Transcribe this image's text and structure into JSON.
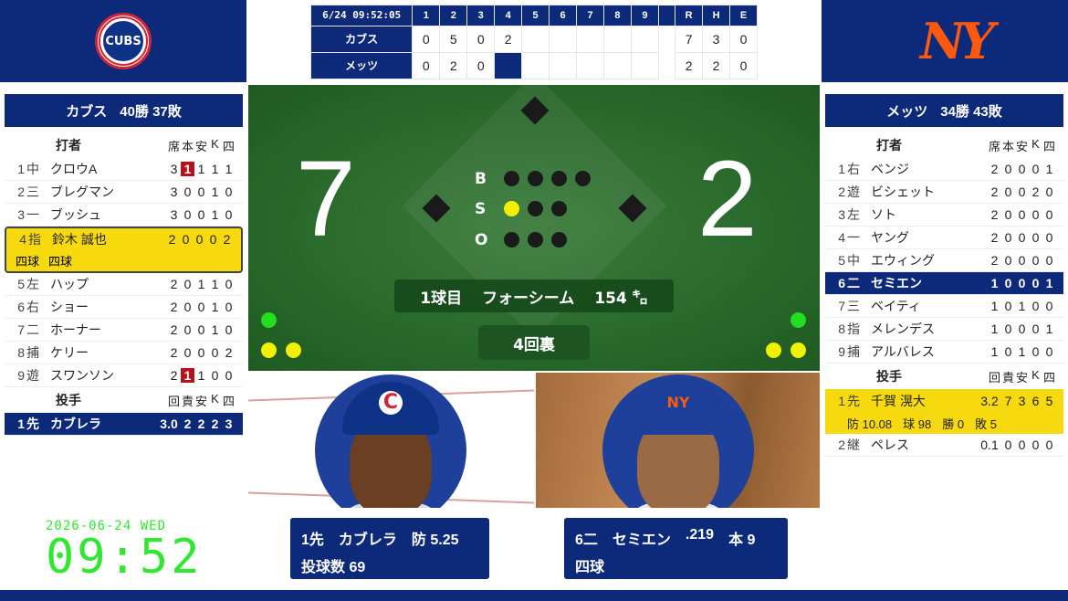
{
  "linescore": {
    "time": "6/24 09:52:05",
    "innings": [
      "1",
      "2",
      "3",
      "4",
      "5",
      "6",
      "7",
      "8",
      "9"
    ],
    "rhe": [
      "R",
      "H",
      "E"
    ],
    "teams": [
      {
        "name": "カブス",
        "scores": [
          "0",
          "5",
          "0",
          "2",
          "",
          "",
          "",
          "",
          ""
        ],
        "r": "7",
        "h": "3",
        "e": "0"
      },
      {
        "name": "メッツ",
        "scores": [
          "0",
          "2",
          "0",
          "",
          "",
          "",
          "",
          "",
          ""
        ],
        "r": "2",
        "h": "2",
        "e": "0"
      }
    ]
  },
  "logos": {
    "cubs": "CUBS",
    "mets": "NY"
  },
  "left_team": {
    "name": "カブス",
    "record": "40勝 37敗",
    "batting_header": "打者",
    "batting_cols": [
      "席",
      "本",
      "安",
      "K",
      "四"
    ],
    "batters": [
      {
        "num": "1",
        "pos": "中",
        "name": "クロウA",
        "stats": [
          "3",
          "1",
          "1",
          "1",
          "1"
        ]
      },
      {
        "num": "2",
        "pos": "三",
        "name": "ブレグマン",
        "stats": [
          "3",
          "0",
          "0",
          "1",
          "0"
        ]
      },
      {
        "num": "3",
        "pos": "一",
        "name": "ブッシュ",
        "stats": [
          "3",
          "0",
          "0",
          "1",
          "0"
        ]
      },
      {
        "num": "4",
        "pos": "指",
        "name": "鈴木 誠也",
        "stats": [
          "2",
          "0",
          "0",
          "0",
          "2"
        ],
        "results": [
          "四球",
          "四球"
        ]
      },
      {
        "num": "5",
        "pos": "左",
        "name": "ハップ",
        "stats": [
          "2",
          "0",
          "1",
          "1",
          "0"
        ]
      },
      {
        "num": "6",
        "pos": "右",
        "name": "ショー",
        "stats": [
          "2",
          "0",
          "0",
          "1",
          "0"
        ]
      },
      {
        "num": "7",
        "pos": "二",
        "name": "ホーナー",
        "stats": [
          "2",
          "0",
          "0",
          "1",
          "0"
        ]
      },
      {
        "num": "8",
        "pos": "捕",
        "name": "ケリー",
        "stats": [
          "2",
          "0",
          "0",
          "0",
          "2"
        ]
      },
      {
        "num": "9",
        "pos": "遊",
        "name": "スワンソン",
        "stats": [
          "2",
          "1",
          "1",
          "0",
          "0"
        ]
      }
    ],
    "pitching_header": "投手",
    "pitching_cols": [
      "回",
      "責",
      "安",
      "K",
      "四"
    ],
    "pitchers": [
      {
        "num": "1",
        "pos": "先",
        "name": "カブレラ",
        "stats": [
          "3.0",
          "2",
          "2",
          "2",
          "3"
        ]
      }
    ]
  },
  "right_team": {
    "name": "メッツ",
    "record": "34勝 43敗",
    "batting_header": "打者",
    "batting_cols": [
      "席",
      "本",
      "安",
      "K",
      "四"
    ],
    "batters": [
      {
        "num": "1",
        "pos": "右",
        "name": "ベンジ",
        "stats": [
          "2",
          "0",
          "0",
          "0",
          "1"
        ]
      },
      {
        "num": "2",
        "pos": "遊",
        "name": "ビシェット",
        "stats": [
          "2",
          "0",
          "0",
          "2",
          "0"
        ]
      },
      {
        "num": "3",
        "pos": "左",
        "name": "ソト",
        "stats": [
          "2",
          "0",
          "0",
          "0",
          "0"
        ]
      },
      {
        "num": "4",
        "pos": "一",
        "name": "ヤング",
        "stats": [
          "2",
          "0",
          "0",
          "0",
          "0"
        ]
      },
      {
        "num": "5",
        "pos": "中",
        "name": "エウィング",
        "stats": [
          "2",
          "0",
          "0",
          "0",
          "0"
        ]
      },
      {
        "num": "6",
        "pos": "二",
        "name": "セミエン",
        "stats": [
          "1",
          "0",
          "0",
          "0",
          "1"
        ]
      },
      {
        "num": "7",
        "pos": "三",
        "name": "ベイティ",
        "stats": [
          "1",
          "0",
          "1",
          "0",
          "0"
        ]
      },
      {
        "num": "8",
        "pos": "指",
        "name": "メレンデス",
        "stats": [
          "1",
          "0",
          "0",
          "0",
          "1"
        ]
      },
      {
        "num": "9",
        "pos": "捕",
        "name": "アルバレス",
        "stats": [
          "1",
          "0",
          "1",
          "0",
          "0"
        ]
      }
    ],
    "pitching_header": "投手",
    "pitching_cols": [
      "回",
      "責",
      "安",
      "K",
      "四"
    ],
    "pitchers": [
      {
        "num": "1",
        "pos": "先",
        "name": "千賀 滉大",
        "stats": [
          "3.2",
          "7",
          "3",
          "6",
          "5"
        ],
        "era": "防 10.08",
        "pitches": "球 98",
        "wins": "勝 0",
        "losses": "敗 5"
      },
      {
        "num": "2",
        "pos": "継",
        "name": "ペレス",
        "stats": [
          "0.1",
          "0",
          "0",
          "0",
          "0"
        ]
      }
    ]
  },
  "field": {
    "away_score": "7",
    "home_score": "2",
    "count_labels": [
      "B",
      "S",
      "O"
    ],
    "balls": 0,
    "strikes": 1,
    "outs": 0,
    "pitch_number": "1球目",
    "pitch_type": "フォーシーム",
    "pitch_speed": "154 ㌔",
    "inning": "4回裏"
  },
  "cards": {
    "pitcher": {
      "slot": "1先",
      "name": "カブレラ",
      "era": "防 5.25",
      "pitch_count": "投球数 69"
    },
    "batter": {
      "slot": "6二",
      "name": "セミエン",
      "avg": ".219",
      "hr": "本 9",
      "last": "四球"
    }
  },
  "clock": {
    "date": "2026-06-24 WED",
    "time": "09:52"
  },
  "colors": {
    "navy": "#0d2a7a",
    "yellow": "#f6d90f",
    "green_clock": "#33e633",
    "cubs_red": "#d12434",
    "mets_orange": "#ff5910"
  }
}
